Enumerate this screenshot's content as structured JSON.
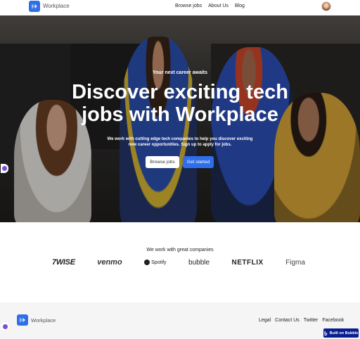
{
  "brand": {
    "name": "Workplace",
    "accent": "#2f6fe8"
  },
  "nav": {
    "browse": "Browse jobs",
    "about": "About Us",
    "blog": "Blog"
  },
  "hero": {
    "eyebrow": "Your next career awaits",
    "headline": "Discover exciting tech jobs with Workplace",
    "sub": "We work with cutting edge tech companies to help you discover exciting new career opportunities. Sign up to apply for jobs.",
    "btn_browse": "Browse jobs",
    "btn_start": "Get started"
  },
  "companies": {
    "title": "We work with great companies",
    "logos": [
      "7WISE",
      "venmo",
      "Spotify",
      "bubble",
      "NETFLIX",
      "Figma"
    ]
  },
  "footer": {
    "name": "Workplace",
    "links": [
      "Legal",
      "Contact Us",
      "Twitter",
      "Facebook"
    ],
    "badge": "Built on Bubble"
  }
}
